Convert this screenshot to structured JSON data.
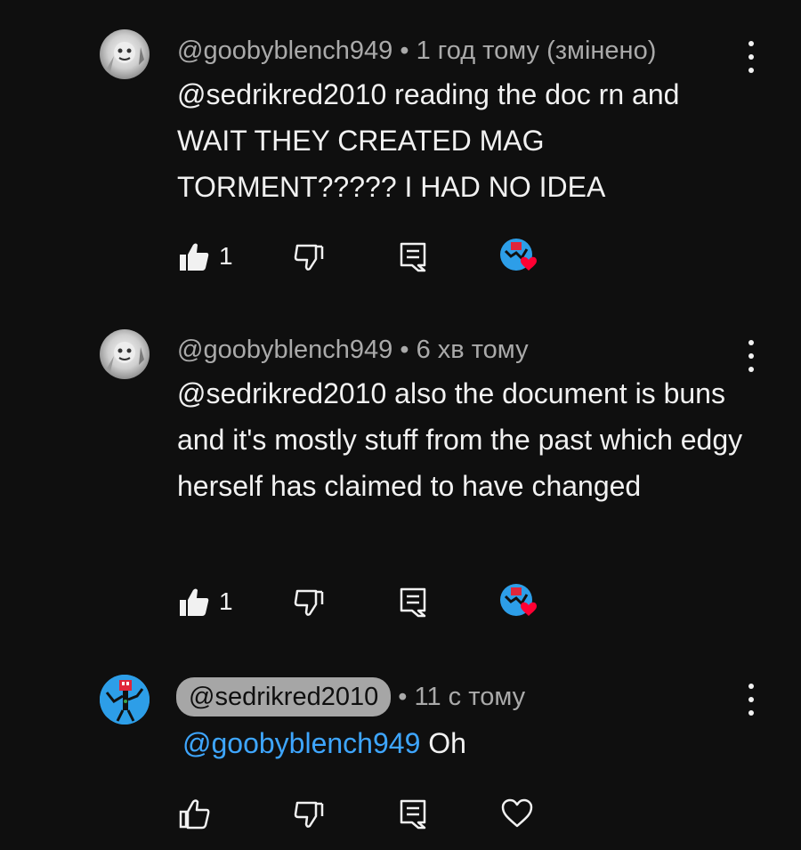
{
  "comments": [
    {
      "author": "@goobyblench949",
      "separator": "•",
      "time": "1 год тому (змінено)",
      "text": "@sedrikred2010 reading the doc rn and WAIT THEY CREATED MAG TORMENT????? I HAD NO IDEA",
      "likes": "1",
      "avatar_icon": "user-avatar-gray",
      "hearted": true
    },
    {
      "author": "@goobyblench949",
      "separator": "•",
      "time": "6 хв тому",
      "text": "@sedrikred2010 also the document is buns and it's mostly stuff from the past which edgy herself has claimed to have changed",
      "likes": "1",
      "avatar_icon": "user-avatar-gray",
      "hearted": true
    },
    {
      "author": "@sedrikred2010",
      "separator": "•",
      "time": "11 с тому",
      "mention": "@goobyblench949",
      "text": "Oh",
      "likes": "",
      "avatar_icon": "user-avatar-blue",
      "hearted": false
    }
  ],
  "colors": {
    "background": "#0f0f0f",
    "text": "#f1f1f1",
    "meta": "#aaaaaa",
    "mention_link": "#3ea6ff",
    "heart": "#ff0033",
    "author_pill": "#a6a6a6"
  },
  "icons": [
    "like-icon",
    "dislike-icon",
    "reply-icon",
    "creator-heart-icon",
    "heart-outline-icon",
    "more-vert-icon"
  ]
}
